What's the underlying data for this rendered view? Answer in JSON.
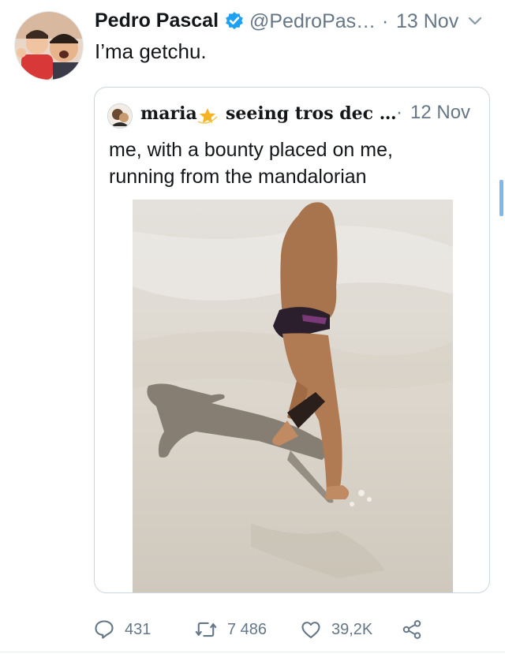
{
  "tweet": {
    "display_name": "Pedro Pascal",
    "verified_icon": "verified-badge-icon",
    "handle": "@PedroPas…",
    "separator": "·",
    "date": "13 Nov",
    "text": "I’ma getchu.",
    "menu_icon": "chevron-down-icon"
  },
  "quote": {
    "name": "maria",
    "star_icon": "star-icon",
    "name_suffix": "seeing tros dec …",
    "separator": "·",
    "date": "12 Nov",
    "text_line1": "me, with a bounty placed on me,",
    "text_line2": "running from the mandalorian",
    "media": "video-thumbnail"
  },
  "actions": {
    "reply_count": "431",
    "retweet_count": "7 486",
    "like_count": "39,2K",
    "share_icon": "share-icon"
  },
  "colors": {
    "text": "#14171a",
    "muted": "#657786",
    "verified": "#1da1f2",
    "border": "#ccd6dd"
  }
}
